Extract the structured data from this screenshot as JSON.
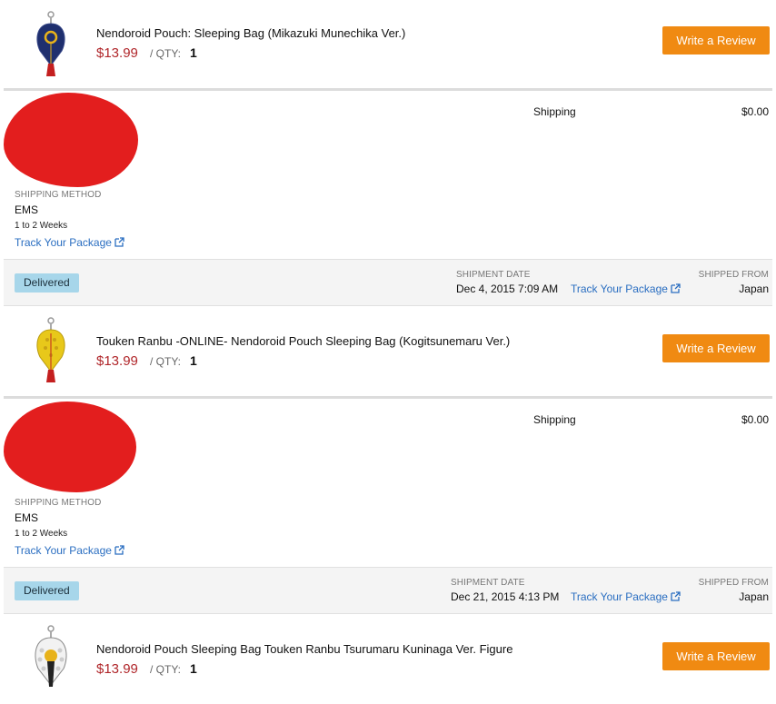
{
  "items": [
    {
      "title": "Nendoroid Pouch: Sleeping Bag (Mikazuki Munechika Ver.)",
      "price": "$13.99",
      "qty_label": "/ QTY:",
      "qty": "1",
      "review_label": "Write a Review",
      "pouch_color": "#1f2f6e",
      "accent_color": "#e8b21a"
    },
    {
      "title": "Touken Ranbu -ONLINE- Nendoroid Pouch Sleeping Bag (Kogitsunemaru Ver.)",
      "price": "$13.99",
      "qty_label": "/ QTY:",
      "qty": "1",
      "review_label": "Write a Review",
      "pouch_color": "#e8c81a",
      "accent_color": "#c41f1f"
    },
    {
      "title": "Nendoroid Pouch Sleeping Bag Touken Ranbu Tsurumaru Kuninaga Ver. Figure",
      "price": "$13.99",
      "qty_label": "/ QTY:",
      "qty": "1",
      "review_label": "Write a Review",
      "pouch_color": "#f2f2f2",
      "accent_color": "#e8b21a"
    }
  ],
  "shipments": [
    {
      "shipping_label": "Shipping",
      "shipping_cost": "$0.00",
      "method_label": "SHIPPING METHOD",
      "method": "EMS",
      "duration": "1 to 2 Weeks",
      "track_label": "Track Your Package",
      "status": "Delivered",
      "date_label": "SHIPMENT DATE",
      "date": "Dec 4, 2015 7:09 AM",
      "from_label": "SHIPPED FROM",
      "from": "Japan"
    },
    {
      "shipping_label": "Shipping",
      "shipping_cost": "$0.00",
      "method_label": "SHIPPING METHOD",
      "method": "EMS",
      "duration": "1 to 2 Weeks",
      "track_label": "Track Your Package",
      "status": "Delivered",
      "date_label": "SHIPMENT DATE",
      "date": "Dec 21, 2015 4:13 PM",
      "from_label": "SHIPPED FROM",
      "from": "Japan"
    }
  ],
  "colors": {
    "accent": "#f08a12",
    "price": "#b0262a",
    "link": "#2a6ec1",
    "badge": "#a7d6ea",
    "redaction": "#e31e1e"
  }
}
